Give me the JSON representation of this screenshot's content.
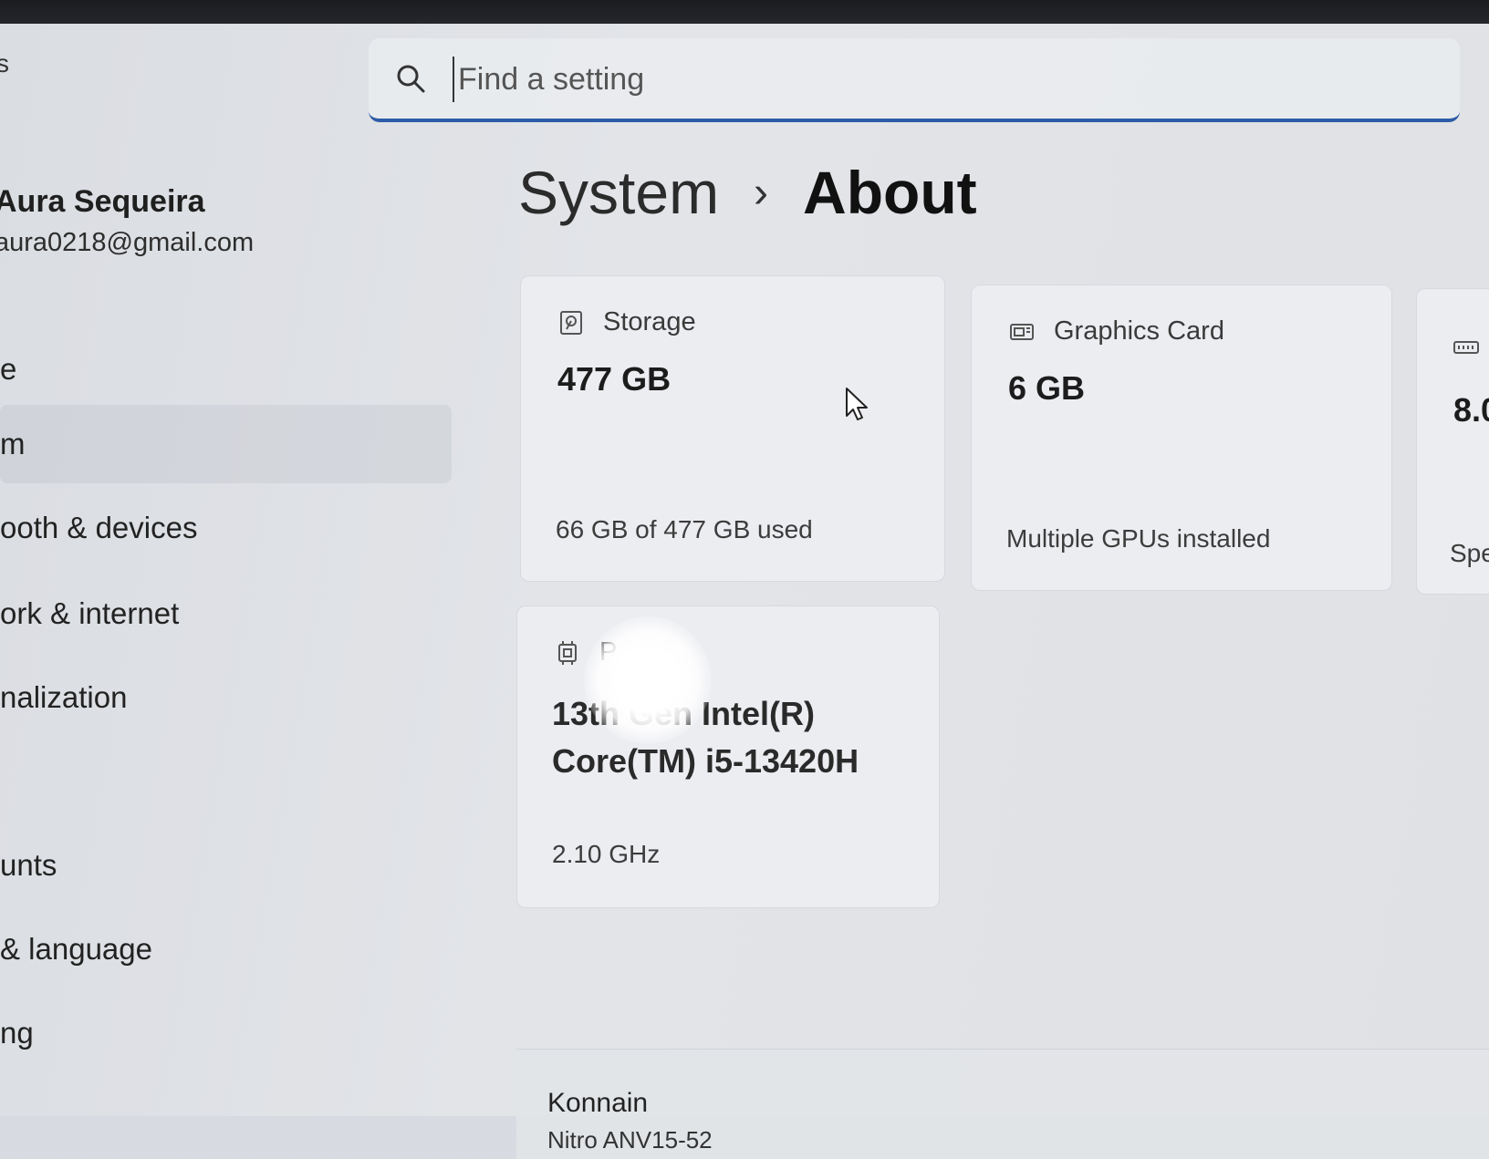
{
  "app": {
    "title": "s"
  },
  "search": {
    "placeholder": "Find a setting"
  },
  "profile": {
    "name": "Aura Sequeira",
    "email": "aura0218@gmail.com"
  },
  "sidebar": {
    "items": [
      {
        "label": "e"
      },
      {
        "label": "m"
      },
      {
        "label": "ooth & devices"
      },
      {
        "label": "ork & internet"
      },
      {
        "label": "nalization"
      },
      {
        "label": "unts"
      },
      {
        "label": "& language"
      },
      {
        "label": "ng"
      }
    ]
  },
  "breadcrumb": {
    "parent": "System",
    "separator": "›",
    "current": "About"
  },
  "cards": {
    "storage": {
      "title": "Storage",
      "value": "477 GB",
      "detail": "66 GB of 477 GB used"
    },
    "graphics": {
      "title": "Graphics Card",
      "value": "6 GB",
      "detail": "Multiple GPUs installed"
    },
    "ram": {
      "value": "8.0",
      "detail": "Spe"
    },
    "processor": {
      "title": "P",
      "value_line1": "13th Gen Intel(R)",
      "value_line2": "Core(TM) i5-13420H",
      "detail": "2.10 GHz"
    }
  },
  "device": {
    "name": "Konnain",
    "model": "Nitro ANV15-52"
  },
  "colors": {
    "accent": "#2d5ca8"
  }
}
